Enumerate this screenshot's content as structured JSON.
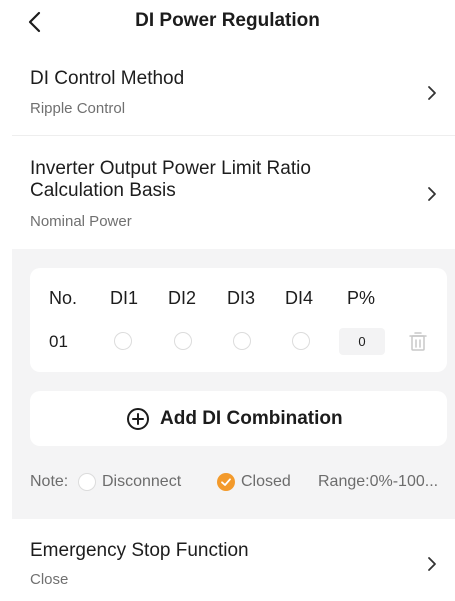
{
  "header": {
    "title": "DI Power Regulation",
    "back_icon": "chevron-left-icon"
  },
  "settings": {
    "control_method": {
      "title": "DI Control Method",
      "value": "Ripple Control"
    },
    "calc_basis": {
      "title": "Inverter Output Power Limit Ratio Calculation Basis",
      "value": "Nominal Power"
    },
    "emergency_stop": {
      "title": "Emergency Stop Function",
      "value": "Close"
    }
  },
  "di_table": {
    "headers": [
      "No.",
      "DI1",
      "DI2",
      "DI3",
      "DI4",
      "P%"
    ],
    "rows": [
      {
        "no": "01",
        "di_states": [
          "disconnect",
          "disconnect",
          "disconnect",
          "disconnect"
        ],
        "percent": "0"
      }
    ]
  },
  "add_button": {
    "label": "Add DI Combination",
    "icon": "plus-circle-icon"
  },
  "note": {
    "label": "Note:",
    "disconnect": "Disconnect",
    "closed": "Closed",
    "range": "Range:0%-100..."
  },
  "colors": {
    "accent": "#f39a2b",
    "panel_bg": "#f4f4f5",
    "text_primary": "#1d1d1d",
    "text_secondary": "#707070"
  }
}
